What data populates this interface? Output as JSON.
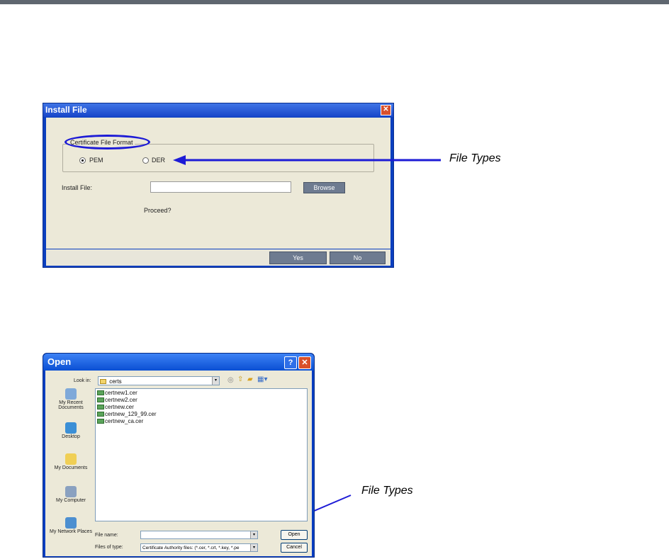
{
  "install_dialog": {
    "title": "Install File",
    "group_label": "Certificate File Format",
    "option_pem": "PEM",
    "option_der": "DER",
    "install_file_label": "Install File:",
    "install_file_value": "",
    "browse_label": "Browse",
    "proceed_text": "Proceed?",
    "yes_label": "Yes",
    "no_label": "No",
    "close_glyph": "✕"
  },
  "annotations": {
    "file_types_1": "File Types",
    "file_types_2": "File Types",
    "arrow_color": "#1d1bd6"
  },
  "open_dialog": {
    "title": "Open",
    "help_glyph": "?",
    "close_glyph": "✕",
    "look_in_label": "Look in:",
    "look_in_value": "certs",
    "places": [
      {
        "label": "My Recent Documents",
        "icon": "recent-documents-icon"
      },
      {
        "label": "Desktop",
        "icon": "desktop-icon"
      },
      {
        "label": "My Documents",
        "icon": "my-documents-icon"
      },
      {
        "label": "My Computer",
        "icon": "my-computer-icon"
      },
      {
        "label": "My Network Places",
        "icon": "network-places-icon"
      }
    ],
    "files": [
      "certnew1.cer",
      "certnew2.cer",
      "certnew.cer",
      "certnew_129_99.cer",
      "certnew_ca.cer"
    ],
    "file_name_label": "File name:",
    "file_name_value": "",
    "files_of_type_label": "Files of type:",
    "files_of_type_value": "Certificate Authority files: (*.cer, *.crt, *.key, *.pe",
    "open_label": "Open",
    "cancel_label": "Cancel"
  }
}
